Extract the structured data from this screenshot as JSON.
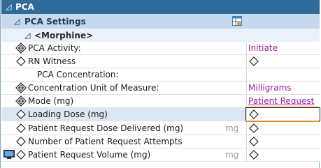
{
  "header": {
    "title": "PCA"
  },
  "settings": {
    "title": "PCA Settings",
    "icon": "grid-table-icon"
  },
  "group": {
    "title": "<Morphine>"
  },
  "rows": [
    {
      "label": "PCA Activity:",
      "icon": "required-diamond-icon",
      "value": "Initiate",
      "value_type": "text"
    },
    {
      "label": "RN Witness",
      "icon": "diamond-icon",
      "value": "",
      "value_type": "diamond"
    },
    {
      "label": "PCA Concentration:",
      "icon": "",
      "value": "",
      "value_type": "none"
    },
    {
      "label": "Concentration Unit of Measure:",
      "icon": "required-diamond-icon",
      "value": "Milligrams",
      "value_type": "text"
    },
    {
      "label": "Mode (mg)",
      "icon": "required-diamond-icon",
      "value": "Patient Request",
      "value_type": "text-underline"
    },
    {
      "label": "Loading Dose (mg)",
      "icon": "diamond-icon",
      "value": "",
      "value_type": "diamond-active"
    },
    {
      "label": "Patient Request Dose Delivered (mg)",
      "icon": "diamond-icon",
      "unit": "mg",
      "value": "",
      "value_type": "diamond"
    },
    {
      "label": "Number of Patient Request Attempts",
      "icon": "diamond-icon",
      "value": "",
      "value_type": "diamond"
    },
    {
      "label": "Patient Request  Volume (mg)",
      "icon": "diamond-icon",
      "prefix_icon": "monitor-icon",
      "unit": "mg",
      "value": "",
      "value_type": "diamond"
    }
  ],
  "colors": {
    "header_bg": "#2f6a98",
    "settings_bg": "#c6d9ec",
    "value_text": "#a020a0",
    "active_line": "#e08a2a"
  }
}
